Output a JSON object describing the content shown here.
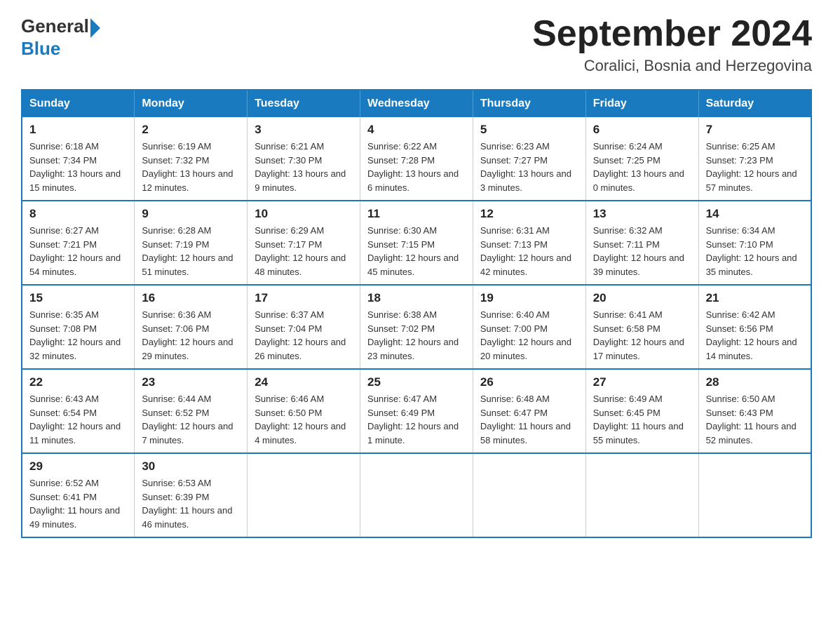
{
  "header": {
    "logo_general": "General",
    "logo_blue": "Blue",
    "month_year": "September 2024",
    "location": "Coralici, Bosnia and Herzegovina"
  },
  "calendar": {
    "days_of_week": [
      "Sunday",
      "Monday",
      "Tuesday",
      "Wednesday",
      "Thursday",
      "Friday",
      "Saturday"
    ],
    "weeks": [
      [
        {
          "day": "1",
          "sunrise": "6:18 AM",
          "sunset": "7:34 PM",
          "daylight": "13 hours and 15 minutes."
        },
        {
          "day": "2",
          "sunrise": "6:19 AM",
          "sunset": "7:32 PM",
          "daylight": "13 hours and 12 minutes."
        },
        {
          "day": "3",
          "sunrise": "6:21 AM",
          "sunset": "7:30 PM",
          "daylight": "13 hours and 9 minutes."
        },
        {
          "day": "4",
          "sunrise": "6:22 AM",
          "sunset": "7:28 PM",
          "daylight": "13 hours and 6 minutes."
        },
        {
          "day": "5",
          "sunrise": "6:23 AM",
          "sunset": "7:27 PM",
          "daylight": "13 hours and 3 minutes."
        },
        {
          "day": "6",
          "sunrise": "6:24 AM",
          "sunset": "7:25 PM",
          "daylight": "13 hours and 0 minutes."
        },
        {
          "day": "7",
          "sunrise": "6:25 AM",
          "sunset": "7:23 PM",
          "daylight": "12 hours and 57 minutes."
        }
      ],
      [
        {
          "day": "8",
          "sunrise": "6:27 AM",
          "sunset": "7:21 PM",
          "daylight": "12 hours and 54 minutes."
        },
        {
          "day": "9",
          "sunrise": "6:28 AM",
          "sunset": "7:19 PM",
          "daylight": "12 hours and 51 minutes."
        },
        {
          "day": "10",
          "sunrise": "6:29 AM",
          "sunset": "7:17 PM",
          "daylight": "12 hours and 48 minutes."
        },
        {
          "day": "11",
          "sunrise": "6:30 AM",
          "sunset": "7:15 PM",
          "daylight": "12 hours and 45 minutes."
        },
        {
          "day": "12",
          "sunrise": "6:31 AM",
          "sunset": "7:13 PM",
          "daylight": "12 hours and 42 minutes."
        },
        {
          "day": "13",
          "sunrise": "6:32 AM",
          "sunset": "7:11 PM",
          "daylight": "12 hours and 39 minutes."
        },
        {
          "day": "14",
          "sunrise": "6:34 AM",
          "sunset": "7:10 PM",
          "daylight": "12 hours and 35 minutes."
        }
      ],
      [
        {
          "day": "15",
          "sunrise": "6:35 AM",
          "sunset": "7:08 PM",
          "daylight": "12 hours and 32 minutes."
        },
        {
          "day": "16",
          "sunrise": "6:36 AM",
          "sunset": "7:06 PM",
          "daylight": "12 hours and 29 minutes."
        },
        {
          "day": "17",
          "sunrise": "6:37 AM",
          "sunset": "7:04 PM",
          "daylight": "12 hours and 26 minutes."
        },
        {
          "day": "18",
          "sunrise": "6:38 AM",
          "sunset": "7:02 PM",
          "daylight": "12 hours and 23 minutes."
        },
        {
          "day": "19",
          "sunrise": "6:40 AM",
          "sunset": "7:00 PM",
          "daylight": "12 hours and 20 minutes."
        },
        {
          "day": "20",
          "sunrise": "6:41 AM",
          "sunset": "6:58 PM",
          "daylight": "12 hours and 17 minutes."
        },
        {
          "day": "21",
          "sunrise": "6:42 AM",
          "sunset": "6:56 PM",
          "daylight": "12 hours and 14 minutes."
        }
      ],
      [
        {
          "day": "22",
          "sunrise": "6:43 AM",
          "sunset": "6:54 PM",
          "daylight": "12 hours and 11 minutes."
        },
        {
          "day": "23",
          "sunrise": "6:44 AM",
          "sunset": "6:52 PM",
          "daylight": "12 hours and 7 minutes."
        },
        {
          "day": "24",
          "sunrise": "6:46 AM",
          "sunset": "6:50 PM",
          "daylight": "12 hours and 4 minutes."
        },
        {
          "day": "25",
          "sunrise": "6:47 AM",
          "sunset": "6:49 PM",
          "daylight": "12 hours and 1 minute."
        },
        {
          "day": "26",
          "sunrise": "6:48 AM",
          "sunset": "6:47 PM",
          "daylight": "11 hours and 58 minutes."
        },
        {
          "day": "27",
          "sunrise": "6:49 AM",
          "sunset": "6:45 PM",
          "daylight": "11 hours and 55 minutes."
        },
        {
          "day": "28",
          "sunrise": "6:50 AM",
          "sunset": "6:43 PM",
          "daylight": "11 hours and 52 minutes."
        }
      ],
      [
        {
          "day": "29",
          "sunrise": "6:52 AM",
          "sunset": "6:41 PM",
          "daylight": "11 hours and 49 minutes."
        },
        {
          "day": "30",
          "sunrise": "6:53 AM",
          "sunset": "6:39 PM",
          "daylight": "11 hours and 46 minutes."
        },
        {
          "day": "",
          "sunrise": "",
          "sunset": "",
          "daylight": ""
        },
        {
          "day": "",
          "sunrise": "",
          "sunset": "",
          "daylight": ""
        },
        {
          "day": "",
          "sunrise": "",
          "sunset": "",
          "daylight": ""
        },
        {
          "day": "",
          "sunrise": "",
          "sunset": "",
          "daylight": ""
        },
        {
          "day": "",
          "sunrise": "",
          "sunset": "",
          "daylight": ""
        }
      ]
    ]
  }
}
